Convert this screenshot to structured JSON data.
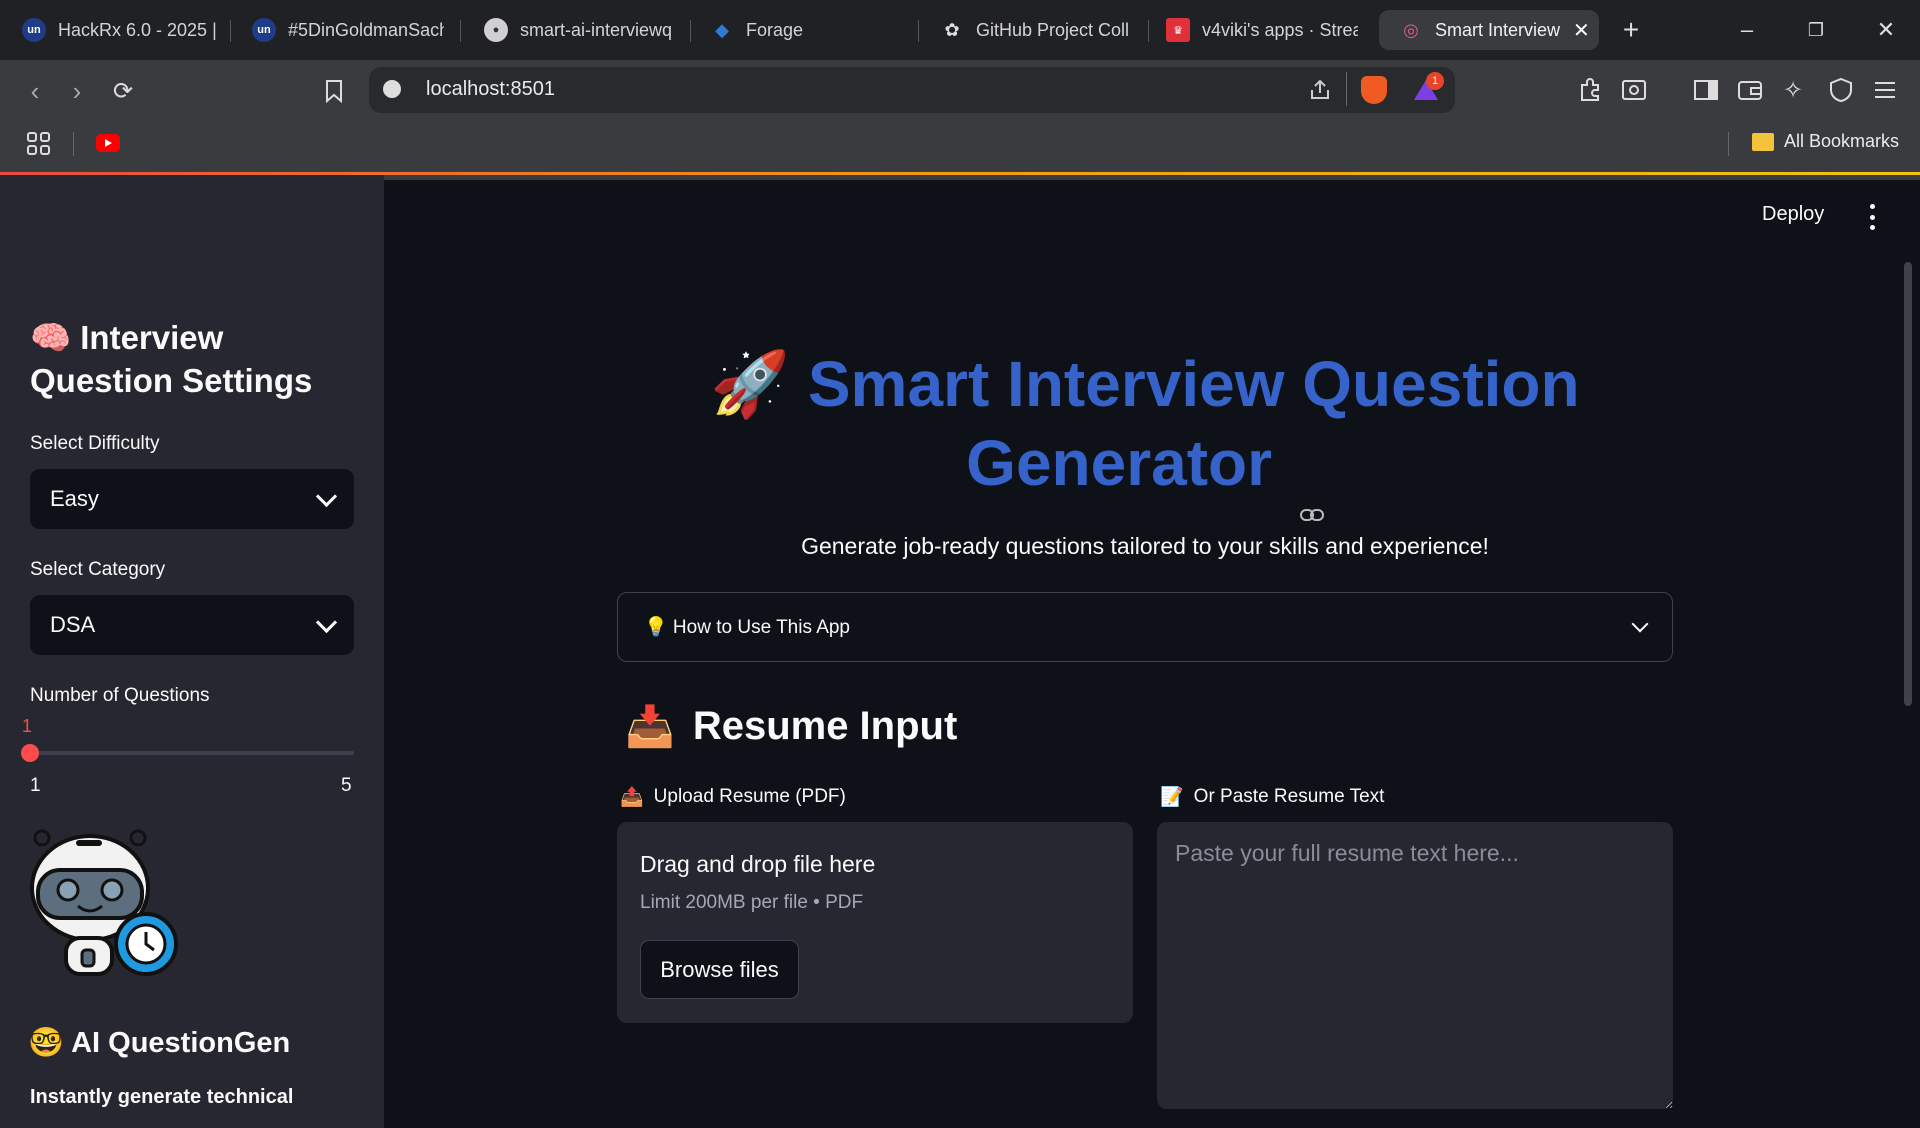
{
  "browser": {
    "tabs": [
      {
        "label": "HackRx 6.0 - 2025 |"
      },
      {
        "label": "#5DinGoldmanSach"
      },
      {
        "label": "smart-ai-interviewq"
      },
      {
        "label": "Forage"
      },
      {
        "label": "GitHub Project Coll"
      },
      {
        "label": "v4viki's apps · Strea"
      },
      {
        "label": "Smart Interview"
      }
    ],
    "url": "localhost:8501",
    "notification_count": "1",
    "bookmarks_label": "All Bookmarks"
  },
  "sidebar": {
    "title": "🧠 Interview Question Settings",
    "difficulty": {
      "label": "Select Difficulty",
      "value": "Easy"
    },
    "category": {
      "label": "Select Category",
      "value": "DSA"
    },
    "questions": {
      "label": "Number of Questions",
      "value": "1",
      "min": "1",
      "max": "5",
      "fraction": 0
    },
    "brand": "🤓 AI QuestionGen",
    "description": "Instantly generate technical"
  },
  "header": {
    "deploy_label": "Deploy"
  },
  "main": {
    "title_emoji": "🚀",
    "title": "Smart Interview Question Generator",
    "subtitle": "Generate job-ready questions tailored to your skills and experience!",
    "expander_label": "💡 How to Use This App",
    "section_emoji": "📥",
    "section_title": "Resume Input",
    "upload_label_emoji": "📤",
    "upload_label": "Upload Resume (PDF)",
    "paste_label_emoji": "📝",
    "paste_label": "Or Paste Resume Text",
    "drag_text": "Drag and drop file here",
    "limit_text": "Limit 200MB per file • PDF",
    "browse_label": "Browse files",
    "paste_placeholder": "Paste your full resume text here..."
  },
  "colors": {
    "accent": "#ff4b4b",
    "title_blue": "#3563c9",
    "bg": "#0e1117",
    "sidebar_bg": "#262730"
  }
}
